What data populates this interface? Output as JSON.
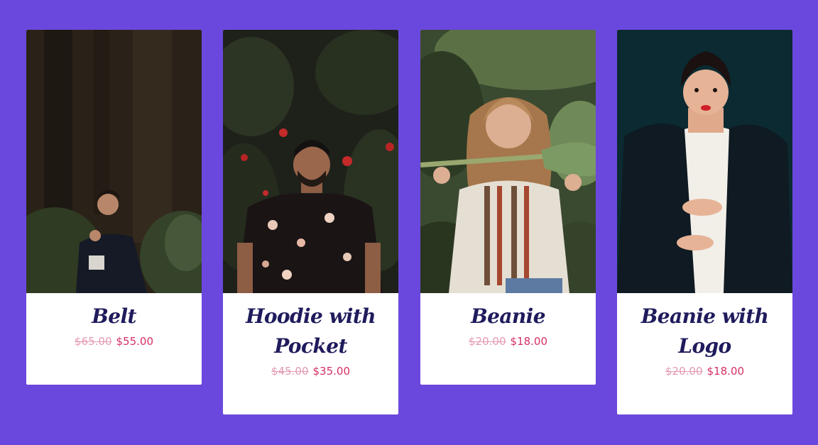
{
  "products": [
    {
      "title": "Belt",
      "old_price": "$65.00",
      "price": "$55.00",
      "image": "man-in-forest-photo"
    },
    {
      "title": "Hoodie with Pocket",
      "old_price": "$45.00",
      "price": "$35.00",
      "image": "man-floral-shirt-photo"
    },
    {
      "title": "Beanie",
      "old_price": "$20.00",
      "price": "$18.00",
      "image": "woman-with-leaf-photo"
    },
    {
      "title": "Beanie with Logo",
      "old_price": "$20.00",
      "price": "$18.00",
      "image": "woman-black-blazer-photo"
    }
  ],
  "colors": {
    "background": "#6b48dd",
    "title": "#1f1b5c",
    "old_price": "#e39ab3",
    "price": "#d62f63"
  }
}
